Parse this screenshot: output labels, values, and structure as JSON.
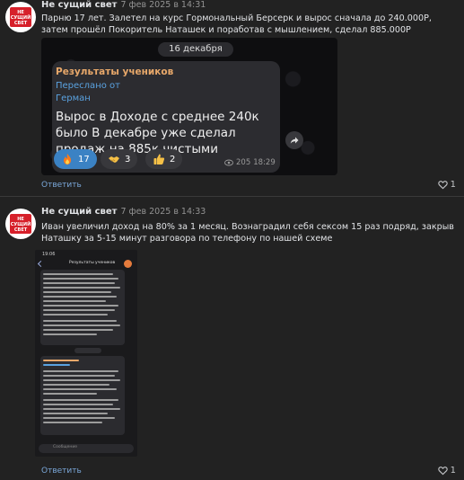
{
  "posts": [
    {
      "author": "Не сущий свет",
      "date": "7 фев 2025 в 14:31",
      "text": "Парню 17 лет. Залетел на курс Гормональный Берсерк и вырос сначала до 240.000Р, затем прошёл Покоритель Наташек и поработав с мышлением, сделал 885.000Р",
      "reply_label": "Ответить",
      "likes": "1",
      "image": {
        "date_pill": "16 декабря",
        "channel": "Результаты учеников",
        "forwarded": "Переслано от",
        "from": "Герман",
        "message": "Вырос в Доходе с среднее  240к было В декабре уже сделал продаж на 885к чистыми",
        "reactions": [
          {
            "icon": "fire-icon",
            "count": "17"
          },
          {
            "icon": "handshake-icon",
            "count": "3"
          },
          {
            "icon": "thumbs-up-icon",
            "count": "2"
          }
        ],
        "views": "205",
        "time": "18:29"
      }
    },
    {
      "author": "Не сущий свет",
      "date": "7 фев 2025 в 14:33",
      "text": "Иван увеличил доход на 80% за 1 месяц. Вознаградил себя сексом 15 раз подряд, закрыв Наташку за 5-15 минут разговора по телефону по нашей схеме",
      "reply_label": "Ответить",
      "likes": "1",
      "image": {
        "status_time": "19:06",
        "chat_name": "Результаты учеников",
        "input_placeholder": "Сообщение"
      }
    }
  ],
  "colors": {
    "background": "#222222",
    "link": "#7aa7d8",
    "accent_orange": "#e8a86a",
    "telegram_blue": "#5aa2e0"
  }
}
